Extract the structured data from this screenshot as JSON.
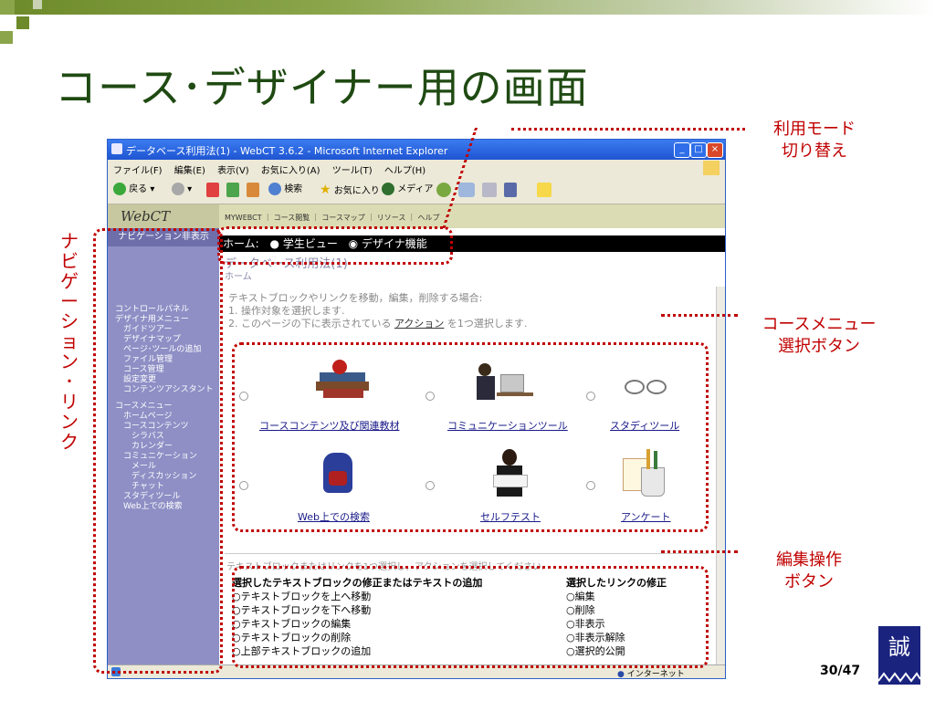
{
  "slide": {
    "title": "コース･デザイナー用の画面",
    "page_number": "30/47",
    "logo_char": "誠"
  },
  "annotations": {
    "mode_switch": [
      "利用モード",
      "切り替え"
    ],
    "course_menu": [
      "コースメニュー",
      "選択ボタン"
    ],
    "edit_ops": [
      "編集操作",
      "ボタン"
    ],
    "navigation": "ナビゲーション･リンク"
  },
  "browser": {
    "title": "データベース利用法(1) - WebCT 3.6.2 - Microsoft Internet Explorer",
    "menu": [
      "ファイル(F)",
      "編集(E)",
      "表示(V)",
      "お気に入り(A)",
      "ツール(T)",
      "ヘルプ(H)"
    ],
    "toolbar": {
      "back": "戻る",
      "search": "検索",
      "favorites": "お気に入り",
      "media": "メディア"
    },
    "status_right": "インターネット",
    "colors": {
      "titlebar": "#2260d8",
      "sidebar": "#8f8fc6",
      "accent_red": "#c00000"
    }
  },
  "webct": {
    "logo": "WebCT",
    "top_nav": "MYWEBCT ｜ コース閲覧 ｜ コースマップ ｜ リソース ｜ ヘルプ",
    "nav_hide": "ナビゲーション非表示",
    "mode_label": "ホーム:",
    "mode_options": [
      "学生ビュー",
      "デザイナ機能"
    ],
    "page_title": "データベース利用法(1)",
    "breadcrumb": "ホーム",
    "instructions": [
      "テキストブロックやリンクを移動，編集，削除する場合:",
      "1. 操作対象を選択します.",
      "2. このページの下に表示されている"
    ],
    "instructions_link": "アクション",
    "instructions_tail": " を1つ選択します.",
    "sidebar_groups": [
      {
        "label": "コントロールパネル"
      },
      {
        "label": "デザイナ用メニュー"
      },
      {
        "label": "　ガイドツアー"
      },
      {
        "label": "　デザイナマップ"
      },
      {
        "label": "　ページ･ツールの追加"
      },
      {
        "label": "　ファイル管理"
      },
      {
        "label": "　コース管理"
      },
      {
        "label": "　設定変更"
      },
      {
        "label": "　コンテンツアシスタント"
      }
    ],
    "sidebar_course": [
      "コースメニュー",
      "　ホームページ",
      "　コースコンテンツ",
      "　　シラバス",
      "　　カレンダー",
      "　コミュニケーション",
      "　　メール",
      "　　ディスカッション",
      "　　チャット",
      "　スタディツール",
      "　Web上での検索"
    ],
    "course_items": [
      {
        "label": "コースコンテンツ及び関連教材",
        "icon": "books-apple-icon"
      },
      {
        "label": "コミュニケーションツール",
        "icon": "people-computer-icon"
      },
      {
        "label": "スタディツール",
        "icon": "glasses-icon"
      },
      {
        "label": "Web上での検索",
        "icon": "backpack-icon"
      },
      {
        "label": "セルフテスト",
        "icon": "student-reading-icon"
      },
      {
        "label": "アンケート",
        "icon": "pencil-cup-icon"
      }
    ],
    "actions_hint": "テキストブロックまたはリンクを1つ選択し，アクションを選択してください.",
    "text_actions_header": "選択したテキストブロックの修正またはテキストの追加",
    "text_actions": [
      "テキストブロックを上へ移動",
      "テキストブロックを下へ移動",
      "テキストブロックの編集",
      "テキストブロックの削除",
      "上部テキストブロックの追加"
    ],
    "link_actions_header": "選択したリンクの修正",
    "link_actions": [
      "編集",
      "削除",
      "非表示",
      "非表示解除",
      "選択的公開"
    ]
  }
}
